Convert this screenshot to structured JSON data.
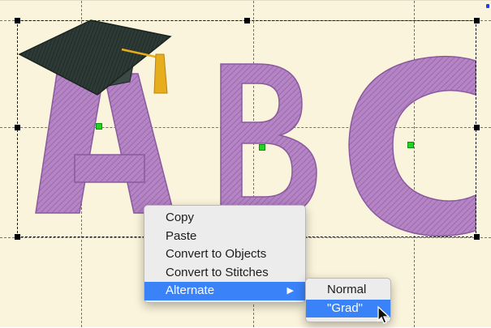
{
  "canvas": {
    "background": "#fbf4dc",
    "letters": [
      "A",
      "B",
      "C"
    ],
    "letter_color": "#b484c4",
    "cap_color": "#2d3a35",
    "tassel_color": "#e6ad1c"
  },
  "context_menu": {
    "items": [
      "Copy",
      "Paste",
      "Convert to Objects",
      "Convert to Stitches",
      "Alternate"
    ],
    "active_item": "Alternate",
    "submenu_arrow": "▶"
  },
  "submenu": {
    "items": [
      "Normal",
      "\"Grad\""
    ],
    "active_item": "\"Grad\""
  },
  "colors": {
    "menu_highlight": "#3a82f7",
    "handle_green": "#22d422"
  }
}
